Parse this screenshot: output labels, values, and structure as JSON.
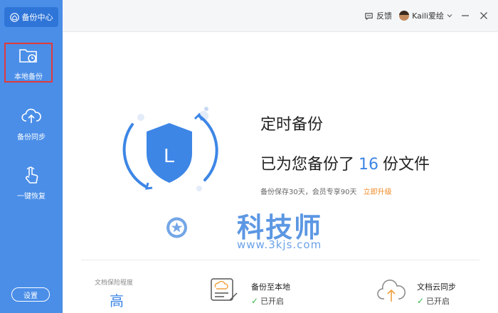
{
  "app": {
    "brand_label": "备份中心"
  },
  "sidebar": {
    "items": [
      {
        "label": "本地备份",
        "icon": "folder-clock-icon"
      },
      {
        "label": "备份同步",
        "icon": "cloud-upload-icon"
      },
      {
        "label": "一键恢复",
        "icon": "hand-pointer-icon"
      }
    ],
    "settings_label": "设置"
  },
  "topbar": {
    "feedback_label": "反馈",
    "user_name": "Kaili爱绘"
  },
  "main": {
    "headline": "定时备份",
    "count_prefix": "已为您备份了",
    "count_value": "16",
    "count_suffix": "份文件",
    "retention_text": "备份保存30天，会员专享90天",
    "upgrade_link": "立即升级",
    "shield_letter": "L"
  },
  "watermark": {
    "text": "科技师",
    "url": "www.3kjs.com"
  },
  "stats": {
    "protection": {
      "label": "文档保险程度",
      "value": "高"
    },
    "local": {
      "title": "备份至本地",
      "status": "已开启"
    },
    "cloud": {
      "title": "文档云同步",
      "status": "已开启"
    }
  },
  "colors": {
    "sidebar": "#4a8ee8",
    "accent": "#3d86e6",
    "upgrade": "#f08a24",
    "active_outline": "#e23a3a",
    "check": "#3ab54a"
  }
}
